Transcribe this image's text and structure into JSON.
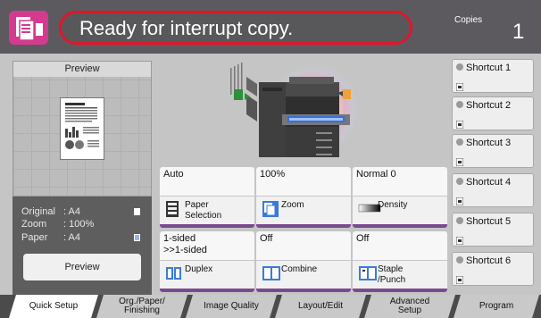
{
  "header": {
    "message": "Ready for interrupt copy.",
    "copies_label": "Copies",
    "copies_value": "1"
  },
  "preview": {
    "title": "Preview",
    "original_label": "Original",
    "original_value": ": A4",
    "zoom_label": "Zoom",
    "zoom_value": ": 100%",
    "paper_label": "Paper",
    "paper_value": ": A4",
    "button_label": "Preview"
  },
  "functions": [
    {
      "value": "Auto",
      "label": "Paper\nSelection"
    },
    {
      "value": "100%",
      "label": "Zoom"
    },
    {
      "value": "Normal 0",
      "label": "Density"
    },
    {
      "value": "1-sided\n>>1-sided",
      "label": "Duplex"
    },
    {
      "value": "Off",
      "label": "Combine"
    },
    {
      "value": "Off",
      "label": "Staple\n/Punch"
    }
  ],
  "shortcuts": [
    {
      "label": "Shortcut 1"
    },
    {
      "label": "Shortcut 2"
    },
    {
      "label": "Shortcut 3"
    },
    {
      "label": "Shortcut 4"
    },
    {
      "label": "Shortcut 5"
    },
    {
      "label": "Shortcut 6"
    }
  ],
  "tabs": [
    {
      "label": "Quick Setup"
    },
    {
      "label": "Org./Paper/\nFinishing"
    },
    {
      "label": "Image Quality"
    },
    {
      "label": "Layout/Edit"
    },
    {
      "label": "Advanced\nSetup"
    },
    {
      "label": "Program"
    }
  ],
  "colors": {
    "header_bg": "#5c5a5e",
    "message_border": "#e0162b",
    "tile_accent": "#7a4a8f"
  }
}
